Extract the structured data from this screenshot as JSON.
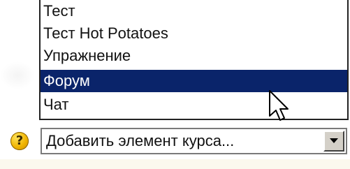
{
  "dropdown": {
    "options": [
      {
        "label": "Тест",
        "selected": false
      },
      {
        "label": "Тест Hot Potatoes",
        "selected": false
      },
      {
        "label": "Упражнение",
        "selected": false
      },
      {
        "label": "Форум",
        "selected": true
      },
      {
        "label": "Чат",
        "selected": false
      }
    ],
    "highlight_color": "#0a246a"
  },
  "select": {
    "value": "Добавить элемент курса..."
  },
  "help": {
    "icon": "help-icon",
    "glyph": "?",
    "color": "#f0b400"
  },
  "cursor": {
    "icon": "mouse-pointer-icon"
  }
}
